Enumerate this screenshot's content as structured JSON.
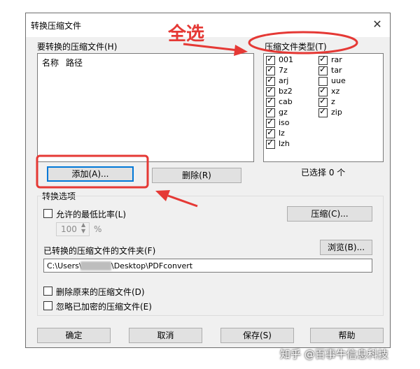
{
  "window": {
    "title": "转换压缩文件",
    "close_glyph": "✕"
  },
  "files_panel": {
    "label": "要转换的压缩文件(H)",
    "columns": [
      "名称",
      "路径"
    ]
  },
  "types_panel": {
    "label": "压缩文件类型(T)",
    "left_items": [
      {
        "name": "001",
        "checked": true
      },
      {
        "name": "7z",
        "checked": true
      },
      {
        "name": "arj",
        "checked": true
      },
      {
        "name": "bz2",
        "checked": true
      },
      {
        "name": "cab",
        "checked": true
      },
      {
        "name": "gz",
        "checked": true
      },
      {
        "name": "iso",
        "checked": true
      },
      {
        "name": "lz",
        "checked": true
      },
      {
        "name": "lzh",
        "checked": true
      }
    ],
    "right_items": [
      {
        "name": "rar",
        "checked": true
      },
      {
        "name": "tar",
        "checked": true
      },
      {
        "name": "uue",
        "checked": false
      },
      {
        "name": "xz",
        "checked": true
      },
      {
        "name": "z",
        "checked": true
      },
      {
        "name": "zip",
        "checked": true
      }
    ],
    "selected_count": "已选择 0 个"
  },
  "buttons": {
    "add": "添加(A)...",
    "delete": "删除(R)",
    "compress": "压缩(C)...",
    "browse": "浏览(B)...",
    "ok": "确定",
    "cancel": "取消",
    "save": "保存(S)",
    "help": "帮助"
  },
  "options": {
    "group_label": "转换选项",
    "min_ratio_label": "允许的最低比率(L)",
    "min_ratio_value": "100",
    "percent": "%",
    "folder_label": "已转换的压缩文件的文件夹(F)",
    "folder_path_prefix": "C:\\Users\\",
    "folder_path_suffix": "\\Desktop\\PDFconvert",
    "delete_original_label": "删除原来的压缩文件(D)",
    "ignore_encrypted_label": "忽略已加密的压缩文件(E)"
  },
  "annotation": {
    "select_all_text": "全选",
    "accent_color": "#e53935"
  },
  "watermark": "知乎 @百事牛信息科技"
}
